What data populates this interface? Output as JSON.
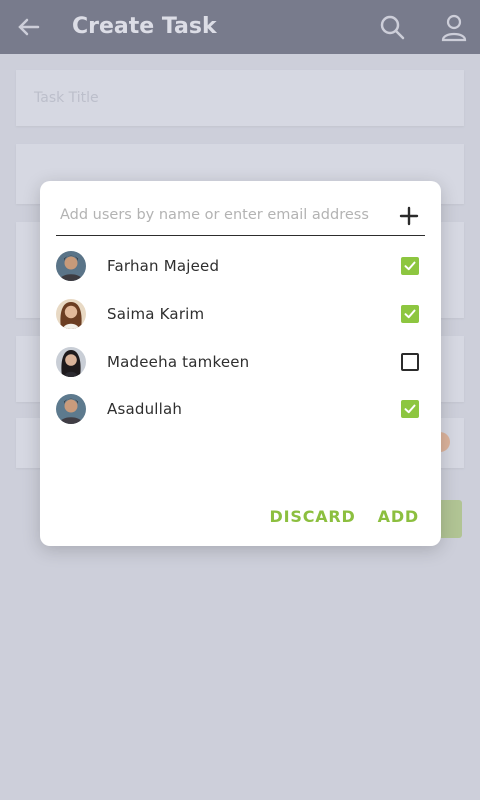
{
  "appbar": {
    "title": "Create Task"
  },
  "background": {
    "field1_placeholder": "Task Title"
  },
  "dialog": {
    "input_placeholder": "Add users by name or enter email address",
    "users": [
      {
        "name": "Farhan Majeed",
        "checked": true
      },
      {
        "name": "Saima Karim",
        "checked": true
      },
      {
        "name": "Madeeha tamkeen",
        "checked": false
      },
      {
        "name": "Asadullah",
        "checked": true
      }
    ],
    "discard_label": "DISCARD",
    "add_label": "ADD"
  },
  "colors": {
    "accent": "#8cbf3f",
    "checkbox_checked": "#8dc640",
    "appbar": "#4e5064"
  }
}
